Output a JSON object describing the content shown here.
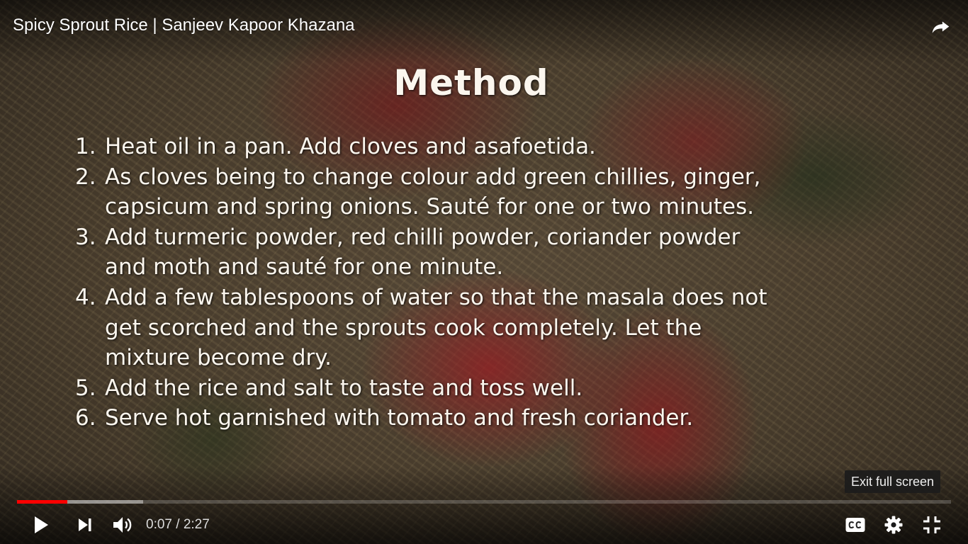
{
  "video": {
    "title": "Spicy Sprout Rice | Sanjeev Kapoor Khazana"
  },
  "slide": {
    "heading": "Method",
    "steps": [
      {
        "num": "1.",
        "lines": [
          "Heat oil in a pan. Add cloves and asafoetida."
        ]
      },
      {
        "num": "2.",
        "lines": [
          "As cloves being to change colour add green chillies, ginger,",
          "capsicum and spring onions. Sauté for one or two minutes."
        ]
      },
      {
        "num": "3.",
        "lines": [
          "Add turmeric powder, red chilli powder, coriander powder",
          "and moth and sauté for one minute."
        ]
      },
      {
        "num": "4.",
        "lines": [
          "Add a few tablespoons of water so that the masala does not",
          "get scorched and the sprouts cook completely. Let the",
          "mixture become dry."
        ]
      },
      {
        "num": "5.",
        "lines": [
          "Add the rice and salt to taste and toss well."
        ]
      },
      {
        "num": "6.",
        "lines": [
          "Serve hot garnished with tomato and fresh coriander."
        ]
      }
    ]
  },
  "tooltip": {
    "text": "Exit full screen"
  },
  "progress": {
    "played_fraction": 0.054,
    "loaded_fraction": 0.135,
    "played_color": "#ff0000"
  },
  "time": {
    "display": "0:07 / 2:27"
  },
  "icons": {
    "share": "share-icon",
    "play": "play-icon",
    "next": "next-icon",
    "volume": "volume-icon",
    "captions": "captions-icon",
    "settings": "gear-icon",
    "exit_fullscreen": "exit-fullscreen-icon"
  }
}
